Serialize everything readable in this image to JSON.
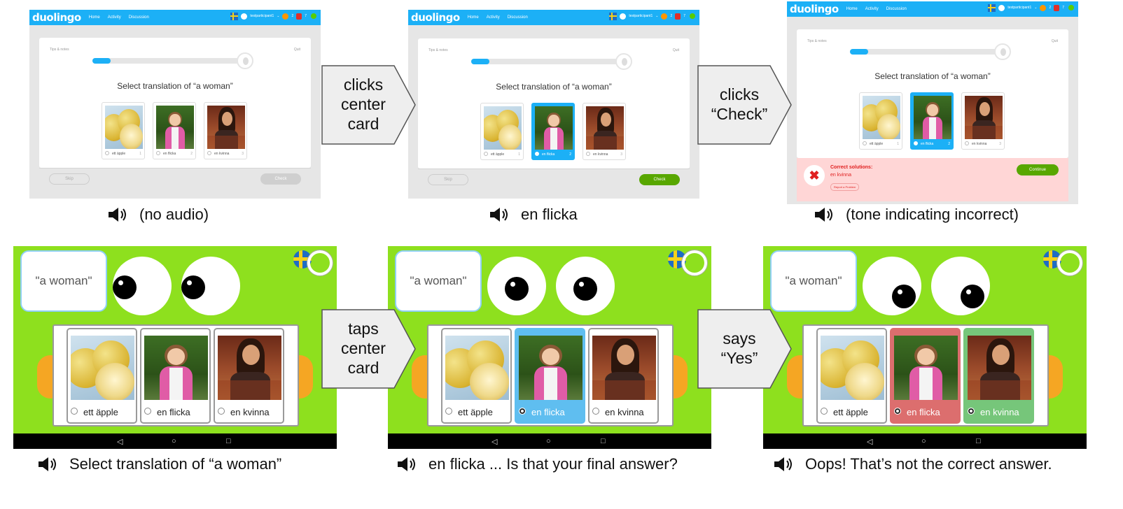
{
  "web": {
    "logo": "duolingo",
    "nav": [
      "Home",
      "Activity",
      "Discussion"
    ],
    "username": "testparticipant1",
    "streak_count": "2",
    "gem_count": "7",
    "tips": "Tips & notes",
    "quit": "Quit",
    "prompt": "Select translation of “a woman”",
    "options": [
      {
        "label": "ett äpple",
        "num": "1"
      },
      {
        "label": "en flicka",
        "num": "2"
      },
      {
        "label": "en kvinna",
        "num": "3"
      }
    ],
    "skip": "Skip",
    "check": "Check",
    "correct_title": "Correct solutions:",
    "correct_value": "en kvinna",
    "report": "Report a Problem",
    "continue": "Continue"
  },
  "arrows": {
    "top1": [
      "clicks",
      "center",
      "card"
    ],
    "top2": [
      "clicks",
      "“Check”"
    ],
    "bottom1": [
      "taps",
      "center",
      "card"
    ],
    "bottom2": [
      "says",
      "“Yes”"
    ]
  },
  "captions": {
    "top1": "(no audio)",
    "top2": "en flicka",
    "top3": "(tone indicating incorrect)",
    "bottom1": "Select translation of “a woman”",
    "bottom2": "en flicka ... Is that your final answer?",
    "bottom3": "Oops! That’s not the correct answer."
  },
  "tablet": {
    "bubble": "\"a woman\"",
    "options": [
      "ett äpple",
      "en flicka",
      "en kvinna"
    ],
    "nav_back": "◁",
    "nav_home": "○",
    "nav_recent": "□"
  },
  "colors": {
    "duolingo_blue": "#1cb0f6",
    "check_green": "#58a700",
    "tablet_green": "#8ee01e",
    "error_pink": "#ffd6d6",
    "selected_blue": "#5fbef0",
    "wrong_red": "#dc6e6e",
    "right_green": "#76c67a"
  }
}
